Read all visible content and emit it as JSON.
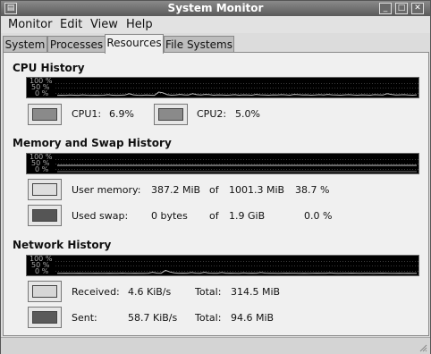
{
  "window": {
    "title": "System Monitor"
  },
  "menubar": {
    "items": [
      "Monitor",
      "Edit",
      "View",
      "Help"
    ]
  },
  "tabs": [
    "System",
    "Processes",
    "Resources",
    "File Systems"
  ],
  "active_tab": "Resources",
  "cpu": {
    "title": "CPU History",
    "graph_labels": [
      "100 %",
      "50 %",
      "0 %"
    ],
    "cpu1": {
      "label": "CPU1:",
      "value": "6.9%",
      "color": "#8a8a8a"
    },
    "cpu2": {
      "label": "CPU2:",
      "value": "5.0%",
      "color": "#8a8a8a"
    },
    "series": [
      2,
      3,
      2,
      4,
      3,
      2,
      5,
      3,
      2,
      3,
      2,
      3,
      6,
      3,
      2,
      3,
      4,
      12,
      5,
      3,
      2,
      4,
      3,
      2,
      22,
      18,
      6,
      3,
      4,
      8,
      5,
      4,
      12,
      6,
      4,
      8,
      6,
      3,
      5,
      4,
      3,
      4,
      6,
      3,
      5,
      4,
      3,
      8,
      5,
      4,
      3,
      5,
      4,
      6,
      5,
      3,
      8,
      6,
      4,
      5,
      3,
      4,
      6,
      4,
      8,
      5,
      4,
      3,
      5,
      6,
      4,
      3,
      5,
      4,
      3,
      6,
      5,
      4,
      12,
      8,
      4,
      5,
      6,
      4,
      3,
      5
    ]
  },
  "memory": {
    "title": "Memory and Swap History",
    "graph_labels": [
      "100 %",
      "50 %",
      "0 %"
    ],
    "user": {
      "label": "User memory:",
      "used": "387.2 MiB",
      "of": "of",
      "total": "1001.3 MiB",
      "percent": "38.7 %",
      "color": "#dedede",
      "level": 38.7
    },
    "swap": {
      "label": "Used swap:",
      "used": "0 bytes",
      "of": "of",
      "total": "1.9 GiB",
      "percent": "0.0 %",
      "color": "#555555",
      "level": 0.0
    }
  },
  "network": {
    "title": "Network History",
    "graph_labels": [
      "100 %",
      "50 %",
      "0 %"
    ],
    "received": {
      "label": "Received:",
      "rate": "4.6 KiB/s",
      "total_label": "Total:",
      "total": "314.5 MiB",
      "color": "#d6d6d6"
    },
    "sent": {
      "label": "Sent:",
      "rate": "58.7 KiB/s",
      "total_label": "Total:",
      "total": "94.6 MiB",
      "color": "#5a5a5a"
    },
    "series": [
      1,
      1,
      2,
      1,
      1,
      2,
      1,
      1,
      1,
      2,
      1,
      1,
      2,
      1,
      1,
      3,
      1,
      1,
      2,
      1,
      1,
      2,
      8,
      3,
      2,
      20,
      10,
      4,
      2,
      3,
      2,
      6,
      3,
      2,
      8,
      3,
      2,
      2,
      6,
      2,
      3,
      2,
      1,
      4,
      2,
      3,
      2,
      6,
      3,
      2,
      2,
      1,
      2,
      3,
      2,
      2,
      1,
      2,
      1,
      2,
      3,
      2,
      2,
      4,
      2,
      1,
      2,
      2,
      3,
      2,
      1,
      2,
      2,
      1,
      2,
      3,
      2,
      1,
      1,
      2,
      1,
      2,
      1,
      1
    ]
  }
}
